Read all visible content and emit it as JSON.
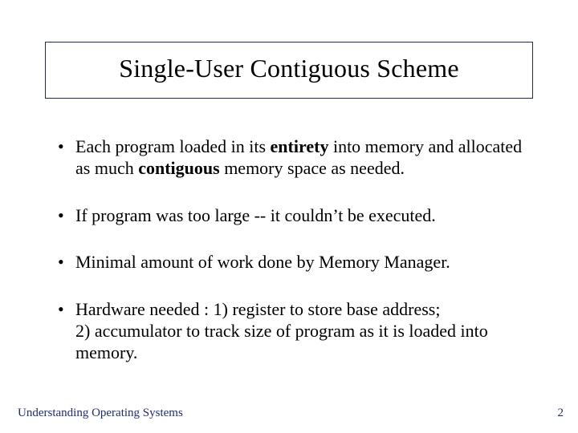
{
  "slide": {
    "title": "Single-User Contiguous Scheme",
    "bullets": [
      {
        "parts": [
          {
            "text": "Each program loaded in its ",
            "bold": false
          },
          {
            "text": "entirety",
            "bold": true
          },
          {
            "text": " into memory and allocated as much ",
            "bold": false
          },
          {
            "text": "contiguous",
            "bold": true
          },
          {
            "text": "  memory space as needed.",
            "bold": false
          }
        ]
      },
      {
        "parts": [
          {
            "text": "If program was too large -- it couldn’t be executed.",
            "bold": false
          }
        ]
      },
      {
        "parts": [
          {
            "text": "Minimal amount of work done by Memory Manager.",
            "bold": false
          }
        ]
      },
      {
        "parts": [
          {
            "text": "Hardware needed : 1) register to store base address; 2) accumulator to track size of program as it is loaded into memory.",
            "bold": false
          }
        ]
      }
    ],
    "footer_left": "Understanding Operating Systems",
    "page_number": "2"
  }
}
